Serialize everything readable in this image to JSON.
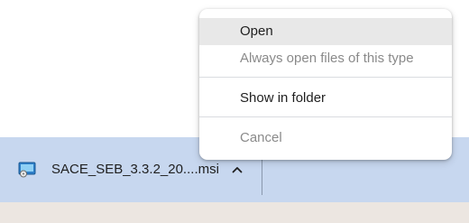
{
  "context_menu": {
    "items": [
      {
        "label": "Open",
        "state": "highlighted"
      },
      {
        "label": "Always open files of this type",
        "state": "disabled"
      },
      {
        "label": "Show in folder",
        "state": "enabled"
      },
      {
        "label": "Cancel",
        "state": "disabled"
      }
    ]
  },
  "download_shelf": {
    "file_name": "SACE_SEB_3.3.2_20....msi",
    "file_icon": "installer-package-icon",
    "menu_toggle_icon": "chevron-up-icon"
  },
  "colors": {
    "shelf_background": "#c7d7ef",
    "menu_highlight": "#e8e8e8",
    "disabled_text": "#8a8a8a",
    "bottom_strip": "#ece6e1"
  }
}
